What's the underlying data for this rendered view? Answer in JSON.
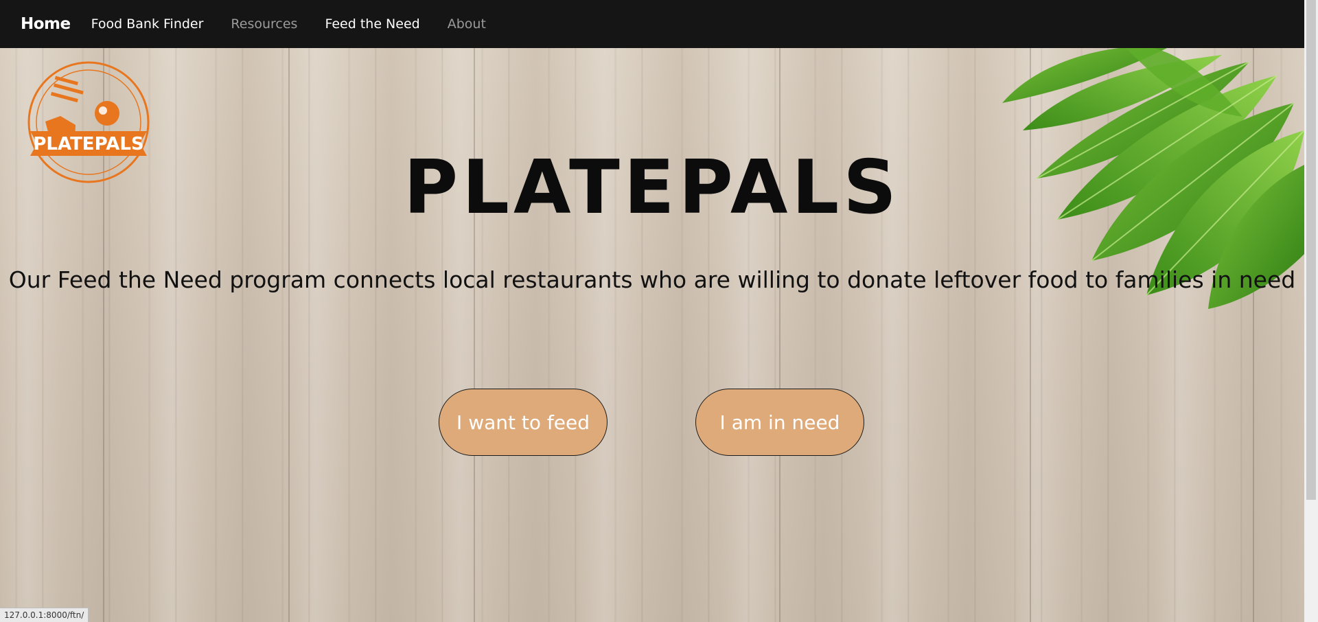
{
  "nav": {
    "brand": "Home",
    "links": [
      {
        "label": "Food Bank Finder",
        "style": "light"
      },
      {
        "label": "Resources",
        "style": "dim"
      },
      {
        "label": "Feed the Need",
        "style": "light"
      },
      {
        "label": "About",
        "style": "dim"
      }
    ]
  },
  "logo": {
    "text": "PLATEPALS",
    "color": "#e8761e"
  },
  "hero": {
    "title": "PLATEPALS",
    "tagline": "Our Feed the Need program connects local restaurants who are willing to donate leftover food to families in need"
  },
  "buttons": {
    "feed_label": "I want to feed",
    "need_label": "I am in need",
    "color": "#dfaa79"
  },
  "status_bar": {
    "url": "127.0.0.1:8000/ftn/"
  },
  "colors": {
    "navbar": "#151515",
    "wood": "#d2c6b7",
    "leaf": "#4a9e22"
  }
}
